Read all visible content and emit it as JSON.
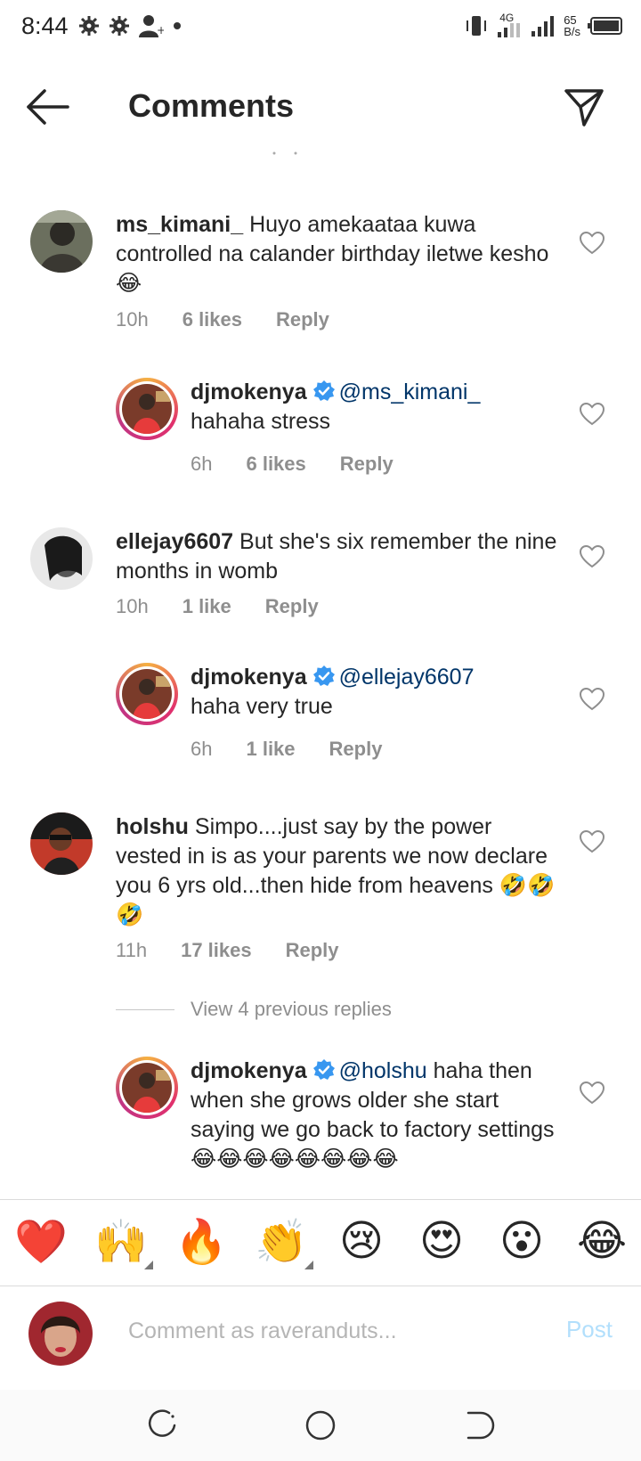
{
  "status_bar": {
    "time": "8:44",
    "network_type": "4G",
    "speed_value": "65",
    "speed_unit": "B/s"
  },
  "header": {
    "title": "Comments"
  },
  "comments": [
    {
      "username": "ms_kimani_",
      "text": "Huyo amekaataa kuwa controlled na calander  birthday iletwe kesho ",
      "emoji": "😂",
      "time": "10h",
      "likes": "6 likes",
      "reply_label": "Reply"
    },
    {
      "username": "djmokenya",
      "mention": "@ms_kimani_",
      "text": "hahaha stress",
      "time": "6h",
      "likes": "6 likes",
      "reply_label": "Reply"
    },
    {
      "username": "ellejay6607",
      "text": "But she's six remember the nine months in womb",
      "time": "10h",
      "likes": "1 like",
      "reply_label": "Reply"
    },
    {
      "username": "djmokenya",
      "mention": "@ellejay6607",
      "text": "haha very true",
      "time": "6h",
      "likes": "1 like",
      "reply_label": "Reply"
    },
    {
      "username": "holshu",
      "text": "Simpo....just say by the power vested in is as your parents we now declare you 6 yrs old...then hide from heavens ",
      "emoji": "🤣🤣🤣",
      "time": "11h",
      "likes": "17 likes",
      "reply_label": "Reply"
    },
    {
      "username": "djmokenya",
      "mention": "@holshu",
      "text": " haha then when she grows older she start saying we go back to factory settings ",
      "emoji": "😂😂😂😂😂😂😂😂"
    }
  ],
  "view_replies": "View 4 previous replies",
  "emoji_bar": [
    "❤️",
    "🙌",
    "🔥",
    "👏",
    "😢",
    "😍",
    "😮",
    "😂"
  ],
  "composer": {
    "placeholder": "Comment as raveranduts...",
    "post_label": "Post"
  },
  "colors": {
    "mention": "#003569",
    "verified": "#3897f0",
    "post_disabled": "#b2dffc",
    "meta_text": "#8e8e8e"
  }
}
